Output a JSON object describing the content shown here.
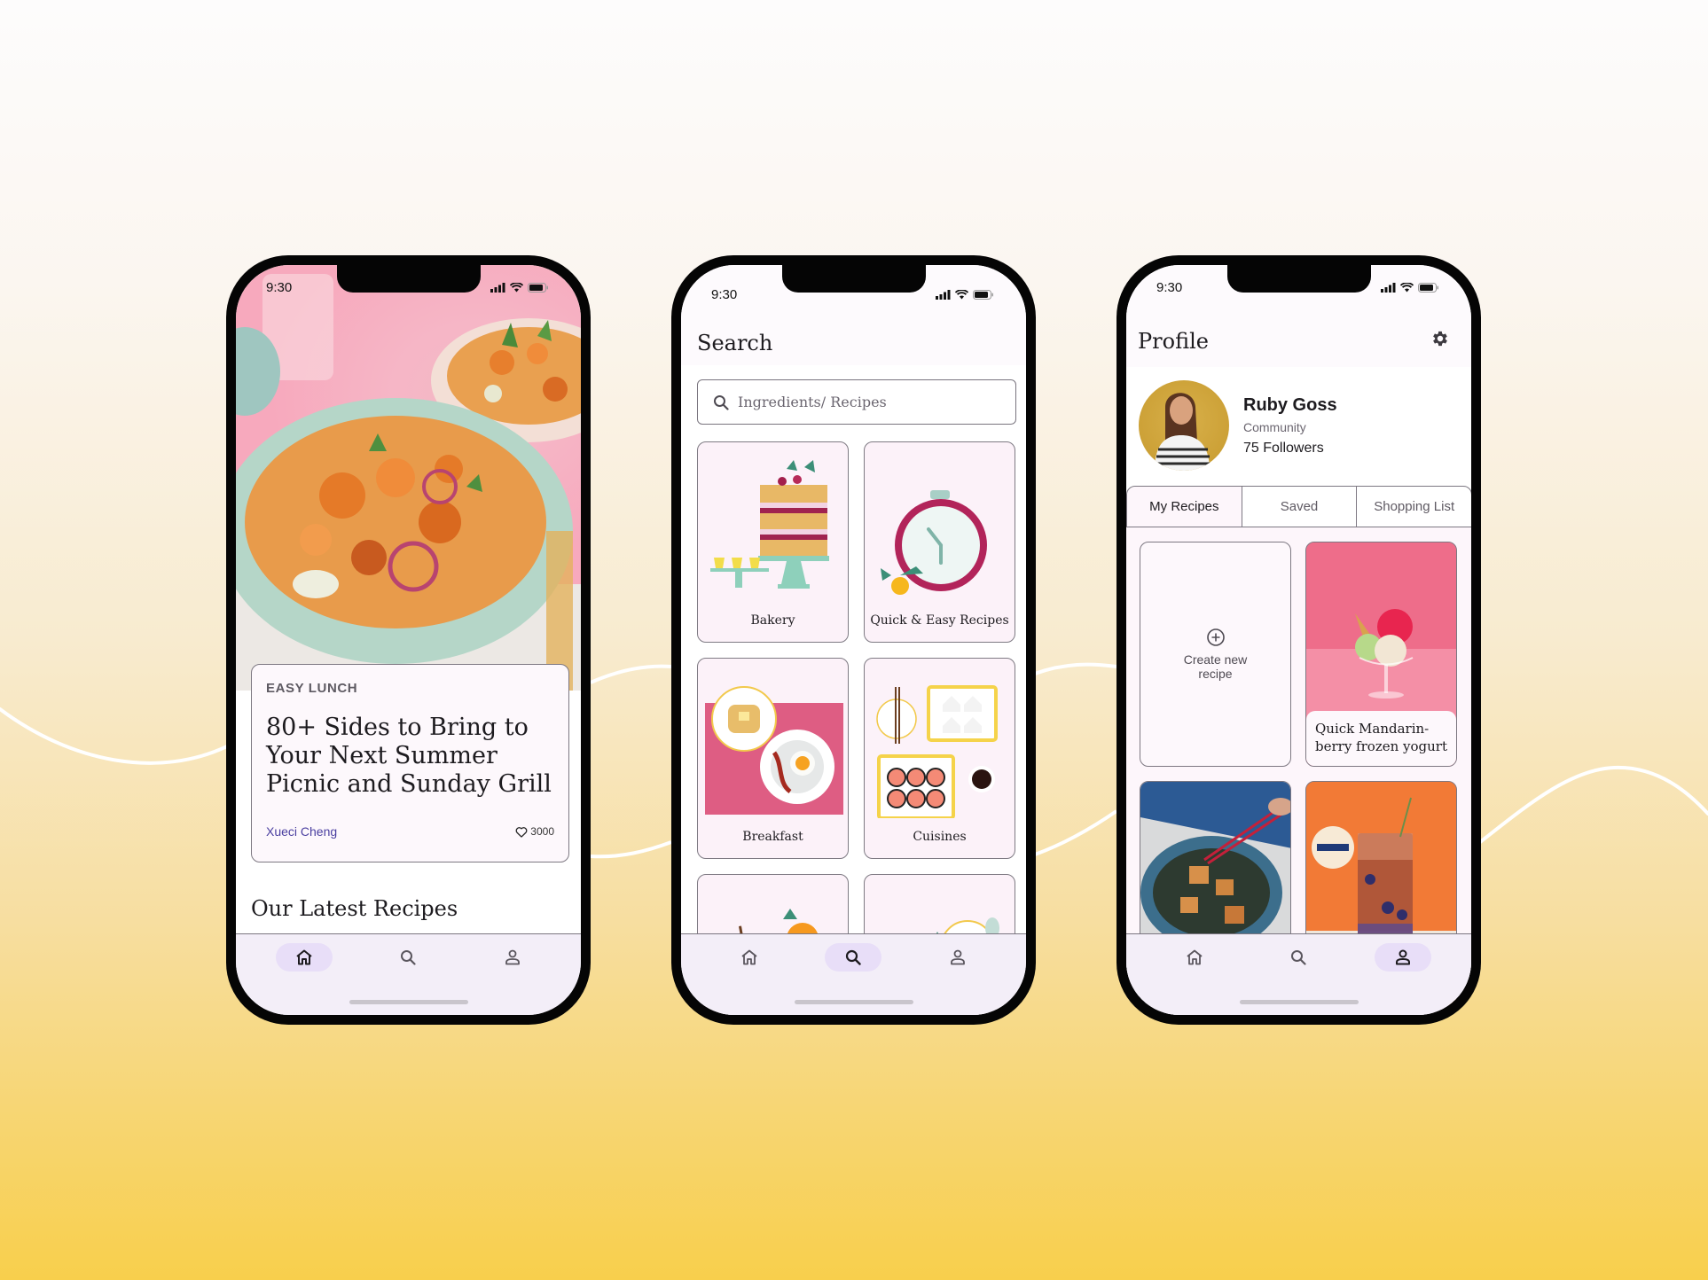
{
  "colors": {
    "accent_nav": "#e8def8",
    "author_link": "#4a3fa0",
    "nav_bg": "#f3eef8",
    "card_bg": "#fcf2f9"
  },
  "status_bar": {
    "time": "9:30",
    "icons": [
      "signal-icon",
      "wifi-icon",
      "battery-icon"
    ]
  },
  "bottom_nav": {
    "items": [
      {
        "name": "home",
        "icon": "home-icon"
      },
      {
        "name": "search",
        "icon": "search-icon"
      },
      {
        "name": "profile",
        "icon": "person-icon"
      }
    ]
  },
  "home_screen": {
    "active_nav": "home",
    "hero_image": "bowl of roasted sweet potato salad on pink table",
    "featured": {
      "tag": "EASY LUNCH",
      "title": "80+ Sides to Bring to Your Next Summer Picnic and Sunday Grill",
      "author": "Xueci Cheng",
      "likes": "3000",
      "like_icon": "heart-outline-icon"
    },
    "section_title": "Our Latest Recipes"
  },
  "search_screen": {
    "active_nav": "search",
    "title": "Search",
    "search": {
      "placeholder": "Ingredients/ Recipes",
      "value": ""
    },
    "categories": [
      {
        "label": "Bakery",
        "art": "layer cake with cupcakes illustration"
      },
      {
        "label": "Quick & Easy Recipes",
        "art": "stopwatch illustration"
      },
      {
        "label": "Breakfast",
        "art": "toast and bacon & egg illustration"
      },
      {
        "label": "Cuisines",
        "art": "sushi and onigiri illustration"
      },
      {
        "label": "",
        "art": "drink with orange slice illustration"
      },
      {
        "label": "",
        "art": "coffee cup illustration"
      }
    ]
  },
  "profile_screen": {
    "active_nav": "profile",
    "title": "Profile",
    "settings_icon": "gear-icon",
    "user": {
      "name": "Ruby Goss",
      "role": "Community",
      "followers": "75 Followers"
    },
    "tabs": [
      {
        "label": "My Recipes",
        "active": true
      },
      {
        "label": "Saved",
        "active": false
      },
      {
        "label": "Shopping List",
        "active": false
      }
    ],
    "create_label": "Create new recipe",
    "recipes": [
      {
        "caption": "Quick Mandarin-berry frozen yogurt",
        "image": "ice cream sundae with sprinkles on pink"
      },
      {
        "caption": "",
        "image": "stir-fried tofu bowl with chopsticks"
      },
      {
        "caption": "",
        "image": "iced berry drink on orange background"
      }
    ]
  }
}
